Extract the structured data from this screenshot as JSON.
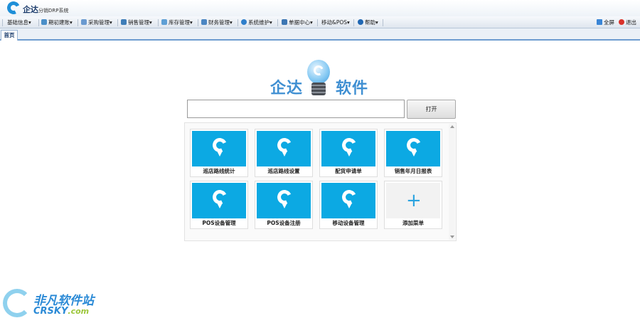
{
  "app": {
    "title": "企达",
    "subtitle": "分销DRP系统"
  },
  "menu": [
    {
      "label": "基础信息▾",
      "icon": "info-icon",
      "color": "#5a7ab0"
    },
    {
      "label": "期初建账▾",
      "icon": "book-icon",
      "color": "#4a8fc8"
    },
    {
      "label": "采购管理▾",
      "icon": "truck-icon",
      "color": "#6a9ad0"
    },
    {
      "label": "销售管理▾",
      "icon": "sales-icon",
      "color": "#3e7db8"
    },
    {
      "label": "库存管理▾",
      "icon": "warehouse-icon",
      "color": "#5e9fd5"
    },
    {
      "label": "财务管理▾",
      "icon": "finance-icon",
      "color": "#4b86c2"
    },
    {
      "label": "系统维护▾",
      "icon": "globe-icon",
      "color": "#2f7fcb"
    },
    {
      "label": "单据中心▾",
      "icon": "document-icon",
      "color": "#3c76b3"
    },
    {
      "label": "移动&POS▾",
      "icon": "",
      "color": ""
    },
    {
      "label": "帮助▾",
      "icon": "help-icon",
      "color": "#2067b3"
    }
  ],
  "system_buttons": {
    "fullscreen": "全屏",
    "exit": "退出"
  },
  "tabs": {
    "home": "首页"
  },
  "brand": {
    "left": "企达",
    "right": "软件"
  },
  "search": {
    "value": "",
    "open_label": "打开"
  },
  "tiles": [
    {
      "label": "巡店路线统计"
    },
    {
      "label": "巡店路线设置"
    },
    {
      "label": "配货申请单"
    },
    {
      "label": "销售年月日报表"
    },
    {
      "label": "POS设备管理"
    },
    {
      "label": "POS设备注册"
    },
    {
      "label": "移动设备管理"
    },
    {
      "label": "添加菜单",
      "add": true
    }
  ],
  "watermark": {
    "cn": "非凡软件站",
    "en": "CRSKY",
    "en_suffix": ".com"
  },
  "colors": {
    "accent": "#0ca9e3",
    "brand": "#3f8fd2"
  }
}
